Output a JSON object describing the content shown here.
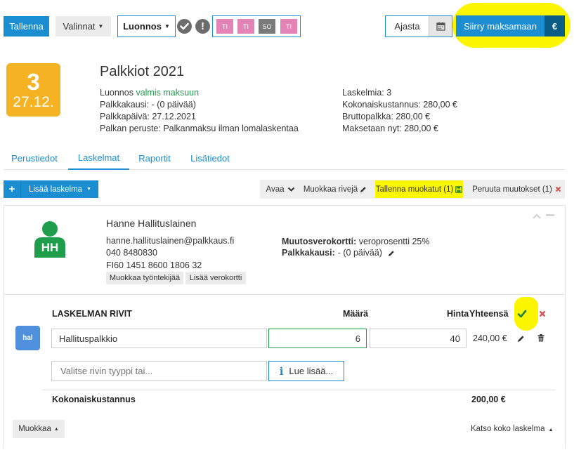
{
  "toolbar": {
    "save_label": "Tallenna",
    "options_label": "Valinnat",
    "draft_label": "Luonnos",
    "days": [
      "TI",
      "TI",
      "SO",
      "TI"
    ],
    "schedule_label": "Ajasta",
    "pay_label": "Siirry maksamaan",
    "euro_symbol": "€"
  },
  "date_badge": {
    "number": "3",
    "date": "27.12."
  },
  "summary": {
    "title": "Palkkiot 2021",
    "status_prefix": "Luonnos",
    "status_value": "valmis maksuun",
    "period": "Palkkakausi: - (0 päivää)",
    "pay_date": "Palkkapäivä: 27.12.2021",
    "basis": "Palkan peruste: Palkanmaksu ilman lomalaskentaa",
    "calc_count": "Laskelmia: 3",
    "total_cost": "Kokonaiskustannus: 280,00 €",
    "gross": "Bruttopalkka: 280,00 €",
    "paid_now": "Maksetaan nyt: 280,00 €"
  },
  "tabs": [
    "Perustiedot",
    "Laskelmat",
    "Raportit",
    "Lisätiedot"
  ],
  "actions": {
    "add_plus": "+",
    "add_calc": "Lisää laskelma",
    "open": "Avaa",
    "edit_rows": "Muokkaa rivejä",
    "save_modified": "Tallenna muokatut (1)",
    "cancel_changes": "Peruuta muutokset (1)"
  },
  "employee": {
    "initials": "HH",
    "name": "Hanne Hallituslainen",
    "email": "hanne.hallituslainen@palkkaus.fi",
    "phone": "040 8480830",
    "iban": "FI60 1451 8600 1806 32",
    "edit_btn": "Muokkaa työntekijää",
    "tax_card_btn": "Lisää verokortti",
    "tax_card_label": "Muutosverokortti:",
    "tax_card_value": "veroprosentti 25%",
    "period_label": "Palkkakausi:",
    "period_value": "- (0 päivää)"
  },
  "rows_table": {
    "header": "LASKELMAN RIVIT",
    "col_qty": "Määrä",
    "col_price": "Hinta",
    "col_total": "Yhteensä",
    "type_badge": "hal",
    "row": {
      "desc": "Hallituspalkkio",
      "qty": "6",
      "price": "40",
      "total": "240,00 €"
    },
    "new_row_placeholder": "Valitse rivin tyyppi tai...",
    "read_more": "Lue lisää...",
    "total_label": "Kokonaiskustannus",
    "total_value": "200,00 €"
  },
  "footer": {
    "edit": "Muokkaa",
    "view_all": "Katso koko laskelma"
  },
  "colors": {
    "primary": "#1a8ed1",
    "success": "#1e9e4a",
    "badge_orange": "#f5b323",
    "day_pink": "#e483b6",
    "day_gray": "#7a7a7a",
    "highlight": "#fbf500",
    "danger": "#d9534f"
  }
}
